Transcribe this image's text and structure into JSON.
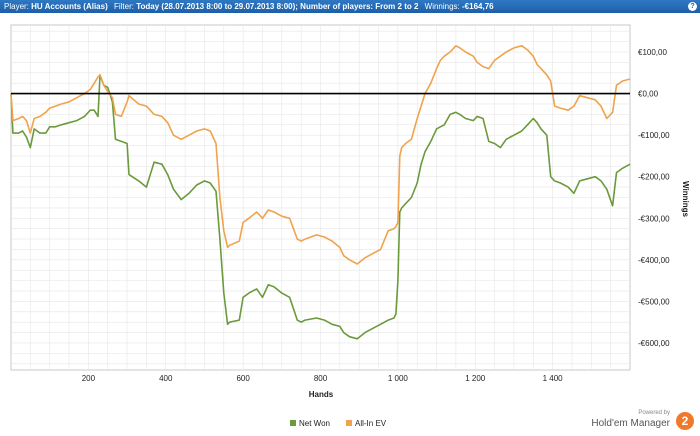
{
  "header": {
    "player_label": "Player:",
    "player_value": "HU Accounts (Alias)",
    "filter_label": "Filter:",
    "filter_value": "Today (28.07.2013 8:00 to 29.07.2013 8:00); Number of players: From 2 to 2",
    "winnings_label": "Winnings:",
    "winnings_value": "-€164,76",
    "help_icon": "question-icon"
  },
  "branding": {
    "powered_by": "Powered by",
    "product": "Hold'em Manager",
    "badge": "2"
  },
  "chart_data": {
    "type": "line",
    "xlabel": "Hands",
    "ylabel": "Winnings",
    "xlim": [
      0,
      1600
    ],
    "ylim": [
      -665,
      165
    ],
    "x_ticks": [
      {
        "v": 200,
        "label": "200"
      },
      {
        "v": 400,
        "label": "400"
      },
      {
        "v": 600,
        "label": "600"
      },
      {
        "v": 800,
        "label": "800"
      },
      {
        "v": 1000,
        "label": "1 000"
      },
      {
        "v": 1200,
        "label": "1 200"
      },
      {
        "v": 1400,
        "label": "1 400"
      }
    ],
    "y_ticks": [
      {
        "v": 100,
        "label": "€100,00"
      },
      {
        "v": 0,
        "label": "€0,00"
      },
      {
        "v": -100,
        "label": "-€100,00"
      },
      {
        "v": -200,
        "label": "-€200,00"
      },
      {
        "v": -300,
        "label": "-€300,00"
      },
      {
        "v": -400,
        "label": "-€400,00"
      },
      {
        "v": -500,
        "label": "-€500,00"
      },
      {
        "v": -600,
        "label": "-€600,00"
      }
    ],
    "grid": true,
    "zero_line": true,
    "legend_position": "bottom-center",
    "series": [
      {
        "name": "Net Won",
        "color": "#6b9a3c",
        "x": [
          0,
          5,
          20,
          30,
          40,
          50,
          60,
          75,
          90,
          100,
          115,
          130,
          150,
          170,
          190,
          205,
          215,
          225,
          230,
          240,
          250,
          262,
          270,
          285,
          300,
          305,
          330,
          350,
          370,
          390,
          405,
          420,
          440,
          460,
          480,
          500,
          515,
          530,
          540,
          550,
          560,
          565,
          590,
          600,
          615,
          635,
          650,
          665,
          680,
          700,
          720,
          740,
          750,
          760,
          790,
          810,
          830,
          850,
          860,
          875,
          895,
          915,
          935,
          955,
          975,
          990,
          995,
          1000,
          1005,
          1010,
          1020,
          1035,
          1050,
          1060,
          1070,
          1085,
          1100,
          1110,
          1120,
          1135,
          1150,
          1160,
          1175,
          1195,
          1205,
          1220,
          1235,
          1250,
          1265,
          1280,
          1300,
          1320,
          1335,
          1350,
          1360,
          1370,
          1385,
          1395,
          1405,
          1420,
          1440,
          1455,
          1470,
          1490,
          1510,
          1525,
          1540,
          1555,
          1565,
          1580,
          1600
        ],
        "y": [
          0,
          -95,
          -95,
          -90,
          -105,
          -130,
          -85,
          -95,
          -95,
          -80,
          -80,
          -75,
          -70,
          -65,
          -55,
          -40,
          -40,
          -55,
          45,
          20,
          15,
          -20,
          -110,
          -115,
          -120,
          -195,
          -210,
          -225,
          -165,
          -170,
          -195,
          -230,
          -255,
          -240,
          -220,
          -210,
          -215,
          -235,
          -350,
          -480,
          -555,
          -550,
          -545,
          -490,
          -480,
          -470,
          -490,
          -460,
          -465,
          -480,
          -490,
          -545,
          -550,
          -545,
          -540,
          -545,
          -555,
          -560,
          -575,
          -585,
          -590,
          -575,
          -565,
          -555,
          -545,
          -540,
          -530,
          -450,
          -285,
          -275,
          -265,
          -250,
          -215,
          -170,
          -140,
          -115,
          -85,
          -80,
          -75,
          -50,
          -45,
          -50,
          -60,
          -65,
          -55,
          -60,
          -115,
          -120,
          -130,
          -110,
          -100,
          -90,
          -75,
          -60,
          -70,
          -85,
          -100,
          -200,
          -210,
          -215,
          -225,
          -240,
          -210,
          -205,
          -200,
          -210,
          -230,
          -270,
          -190,
          -180,
          -170
        ]
      },
      {
        "name": "All-In EV",
        "color": "#f0a24c",
        "x": [
          0,
          5,
          20,
          30,
          40,
          50,
          60,
          75,
          90,
          100,
          115,
          130,
          150,
          170,
          190,
          205,
          215,
          225,
          230,
          240,
          250,
          262,
          270,
          285,
          300,
          305,
          330,
          350,
          370,
          390,
          405,
          420,
          440,
          460,
          480,
          500,
          515,
          530,
          540,
          550,
          560,
          565,
          590,
          600,
          615,
          635,
          650,
          665,
          680,
          700,
          720,
          740,
          750,
          760,
          790,
          810,
          830,
          850,
          860,
          875,
          895,
          915,
          935,
          955,
          975,
          990,
          995,
          1000,
          1005,
          1010,
          1020,
          1035,
          1050,
          1060,
          1070,
          1085,
          1100,
          1110,
          1120,
          1135,
          1150,
          1160,
          1175,
          1195,
          1205,
          1220,
          1235,
          1250,
          1265,
          1280,
          1300,
          1320,
          1335,
          1350,
          1360,
          1370,
          1385,
          1395,
          1405,
          1420,
          1440,
          1455,
          1470,
          1490,
          1510,
          1525,
          1540,
          1555,
          1565,
          1580,
          1600
        ],
        "y": [
          0,
          -65,
          -60,
          -55,
          -65,
          -95,
          -60,
          -55,
          -45,
          -35,
          -30,
          -25,
          -20,
          -10,
          0,
          10,
          25,
          40,
          45,
          20,
          5,
          -10,
          -50,
          -55,
          -20,
          -5,
          -25,
          -30,
          -50,
          -55,
          -70,
          -100,
          -110,
          -100,
          -90,
          -85,
          -90,
          -120,
          -250,
          -330,
          -370,
          -365,
          -355,
          -310,
          -300,
          -285,
          -300,
          -280,
          -285,
          -295,
          -300,
          -350,
          -355,
          -350,
          -340,
          -345,
          -355,
          -370,
          -390,
          -400,
          -410,
          -395,
          -385,
          -375,
          -330,
          -325,
          -320,
          -310,
          -150,
          -130,
          -120,
          -110,
          -60,
          -30,
          0,
          25,
          60,
          80,
          90,
          100,
          115,
          110,
          100,
          90,
          75,
          65,
          60,
          80,
          90,
          100,
          110,
          115,
          105,
          90,
          70,
          60,
          45,
          30,
          -30,
          -35,
          -40,
          -30,
          -5,
          -10,
          -15,
          -30,
          -60,
          -45,
          20,
          30,
          35
        ]
      }
    ]
  }
}
